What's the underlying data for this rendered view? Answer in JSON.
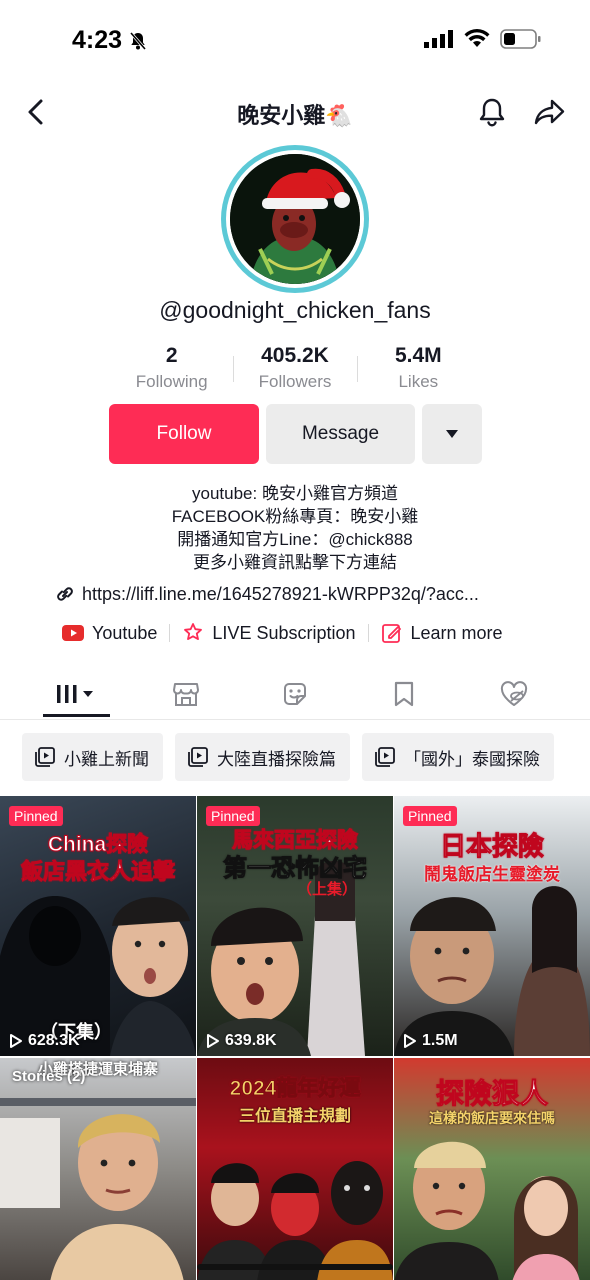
{
  "status": {
    "time": "4:23"
  },
  "header": {
    "title": "晚安小雞🐔"
  },
  "profile": {
    "username": "@goodnight_chicken_fans",
    "stats": [
      {
        "value": "2",
        "label": "Following"
      },
      {
        "value": "405.2K",
        "label": "Followers"
      },
      {
        "value": "5.4M",
        "label": "Likes"
      }
    ],
    "follow_label": "Follow",
    "message_label": "Message",
    "bio": [
      "youtube: 晚安小雞官方頻道",
      "FACEBOOK粉絲專頁：晚安小雞",
      "開播通知官方Line：@chick888",
      "更多小雞資訊點擊下方連結"
    ],
    "link": "https://liff.line.me/1645278921-kWRPP32q/?acc...",
    "shortcuts": [
      "Youtube",
      "LIVE Subscription",
      "Learn more"
    ]
  },
  "tabs": [
    "videos-icon",
    "shop-icon",
    "favorites-icon",
    "saved-icon",
    "liked-icon"
  ],
  "playlists": [
    "小雞上新聞",
    "大陸直播探險篇",
    "「國外」泰國探險"
  ],
  "videos": [
    {
      "pinned": "Pinned",
      "views": "628.3K",
      "title": "China探險",
      "subtitle": "飯店黑衣人追擊",
      "tag": "（下集）"
    },
    {
      "pinned": "Pinned",
      "views": "639.8K",
      "title": "馬來西亞探險",
      "subtitle": "第一恐怖凶宅",
      "tag": "（上集）"
    },
    {
      "pinned": "Pinned",
      "views": "1.5M",
      "title": "日本探險",
      "subtitle": "鬧鬼飯店生靈塗炭"
    },
    {
      "stories": "Stories (2)",
      "title": "小雞搭捷運東埔寨"
    },
    {
      "title": "2024龍年好運",
      "subtitle": "三位直播主規劃"
    },
    {
      "title": "探險狠人",
      "subtitle": "這樣的飯店要來住嗎"
    }
  ],
  "colors": {
    "accent": "#fe2c55",
    "avatar_ring": "#5cc9d6"
  }
}
